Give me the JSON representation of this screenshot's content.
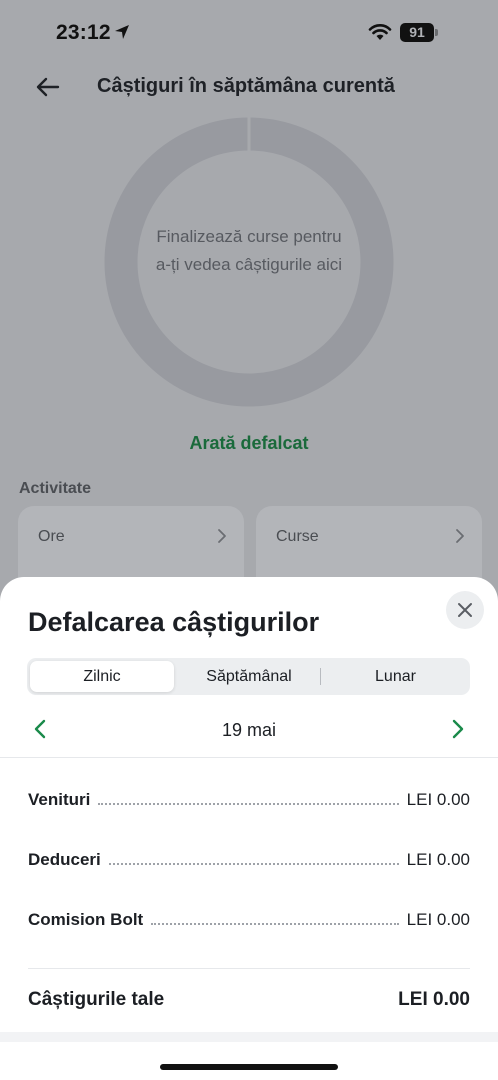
{
  "status_bar": {
    "time": "23:12",
    "battery": "91",
    "icons": [
      "location-arrow-icon",
      "wifi-icon",
      "battery-icon"
    ]
  },
  "header": {
    "title": "Câștiguri în săptămâna curentă",
    "back_icon": "arrow-left-icon"
  },
  "donut": {
    "empty_message": "Finalizează curse pentru a-ți vedea câștigurile aici"
  },
  "show_breakdown_label": "Arată defalcat",
  "activity": {
    "label": "Activitate",
    "cards": [
      {
        "label": "Ore"
      },
      {
        "label": "Curse"
      }
    ]
  },
  "sheet": {
    "title": "Defalcarea câștigurilor",
    "close_icon": "close-icon",
    "tabs": [
      {
        "label": "Zilnic",
        "active": true
      },
      {
        "label": "Săptămânal",
        "active": false
      },
      {
        "label": "Lunar",
        "active": false
      }
    ],
    "date": "19 mai",
    "rows": [
      {
        "label": "Venituri",
        "value": "LEI 0.00"
      },
      {
        "label": "Deduceri",
        "value": "LEI 0.00"
      },
      {
        "label": "Comision Bolt",
        "value": "LEI 0.00"
      }
    ],
    "total": {
      "label": "Câștigurile tale",
      "value": "LEI 0.00"
    }
  },
  "colors": {
    "accent_green": "#1a8a4a",
    "overlay_gray": "#a7a9ad",
    "text_dark": "#1c1f24"
  }
}
